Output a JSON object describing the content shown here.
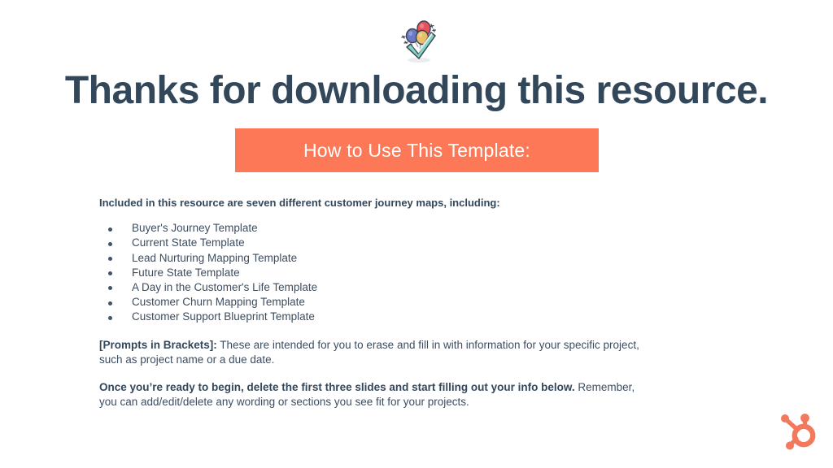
{
  "brand": {
    "accent_color": "#fc7856",
    "text_color": "#33475b",
    "logo_name": "hubspot-sprocket-logo"
  },
  "hero": {
    "icon_name": "celebration-balloons-checkmark-icon"
  },
  "title": "Thanks for downloading this resource.",
  "banner": {
    "label": "How to Use This Template:"
  },
  "body": {
    "intro": "Included in this resource are seven different customer journey maps, including:",
    "templates": [
      "Buyer's Journey Template",
      "Current State Template",
      "Lead Nurturing Mapping Template",
      "Future State Template",
      "A Day in the Customer's Life Template",
      "Customer Churn Mapping Template",
      "Customer Support Blueprint Template"
    ],
    "prompts_paragraph": {
      "bold_lead": "[Prompts in Brackets]:",
      "rest": " These are intended for you to erase and fill in with information for your specific project, such as project name or a due date."
    },
    "begin_paragraph": {
      "bold_lead": "Once you’re ready to begin, delete the first three slides and start filling out your info below.",
      "rest": " Remember, you can add/edit/delete any wording or sections you see fit for your projects."
    }
  }
}
